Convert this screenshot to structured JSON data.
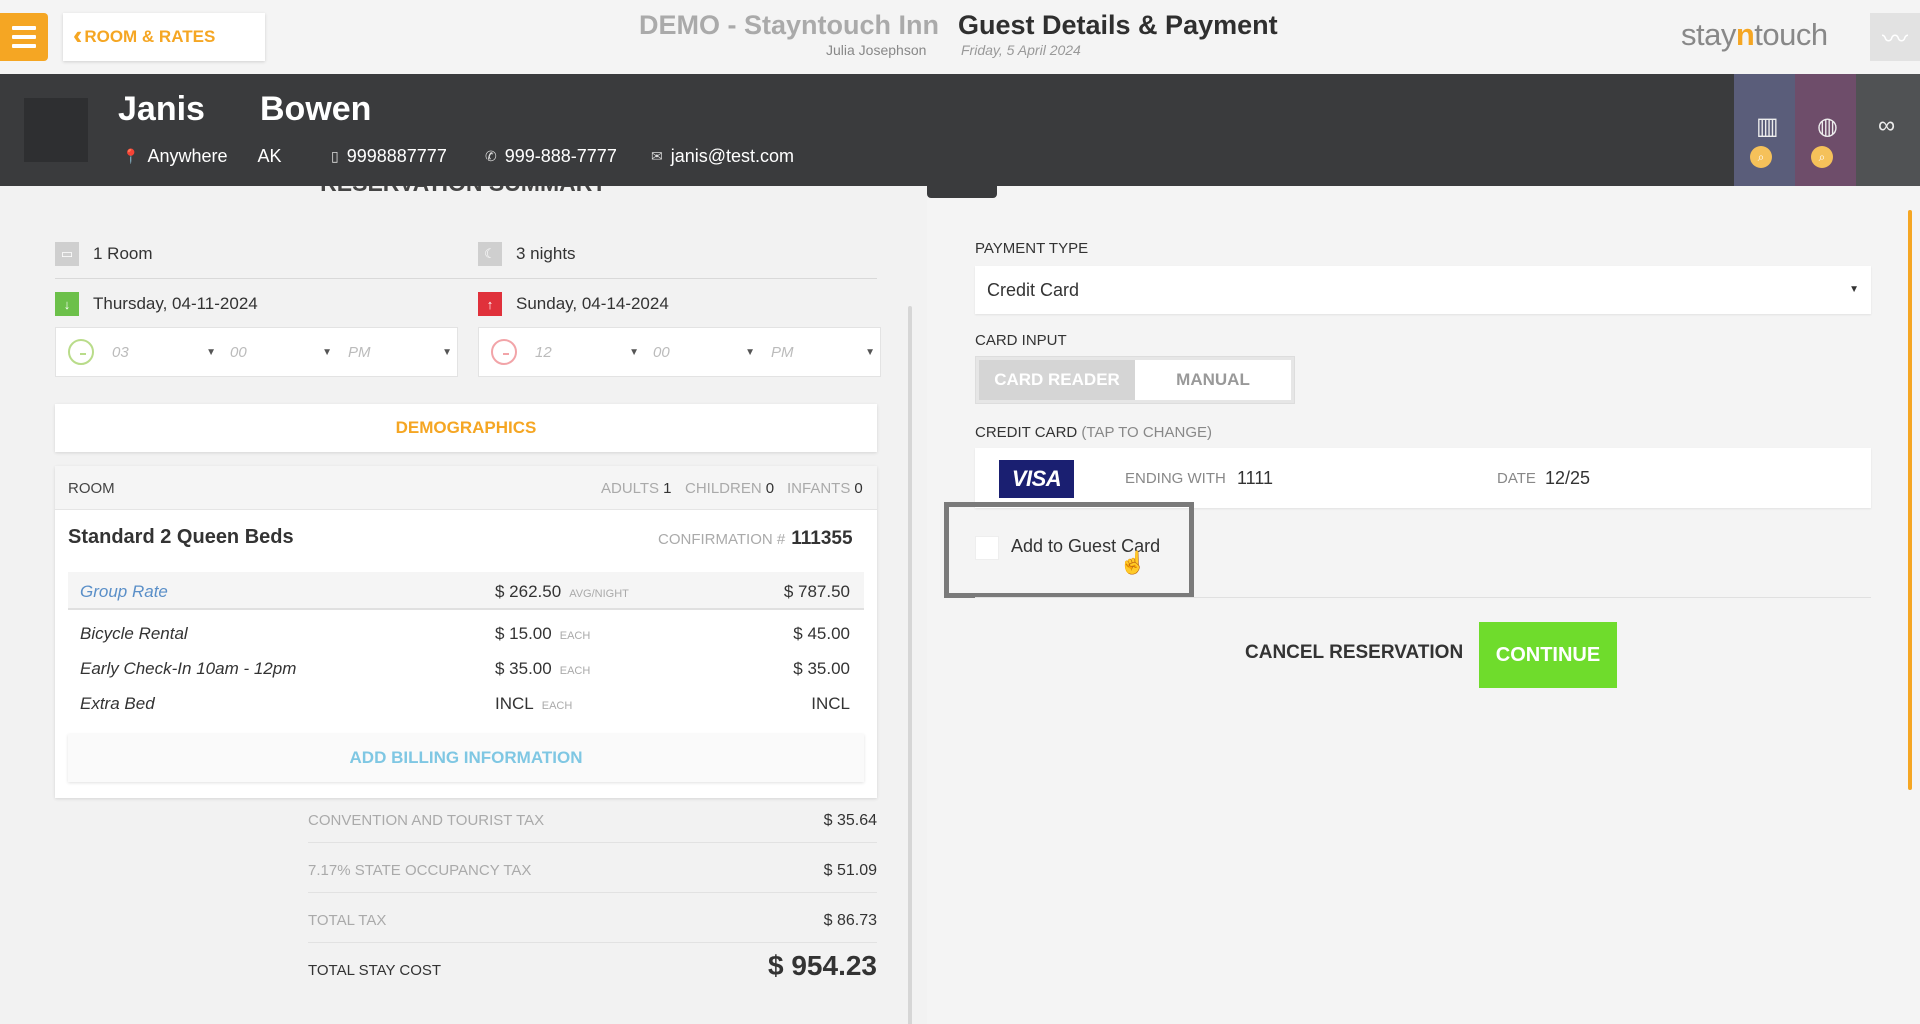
{
  "topbar": {
    "back_label": "ROOM & RATES",
    "hotel_title": "DEMO - Stayntouch Inn",
    "user_name": "Julia Josephson",
    "page_title": "Guest Details & Payment",
    "date": "Friday, 5 April 2024",
    "logo_pre": "stay",
    "logo_mid": "n",
    "logo_post": "touch"
  },
  "guest": {
    "first_name": "Janis",
    "last_name": "Bowen",
    "city": "Anywhere",
    "state": "AK",
    "mobile": "9998887777",
    "phone": "999-888-7777",
    "email": "janis@test.com"
  },
  "summary": {
    "heading": "RESERVATION SUMMARY",
    "rooms": "1 Room",
    "nights": "3 nights",
    "arrival": "Thursday, 04-11-2024",
    "departure": "Sunday, 04-14-2024",
    "arrival_time": {
      "hour": "03",
      "minute": "00",
      "ampm": "PM"
    },
    "departure_time": {
      "hour": "12",
      "minute": "00",
      "ampm": "PM"
    },
    "demographics_label": "DEMOGRAPHICS"
  },
  "room": {
    "label": "ROOM",
    "adults_label": "ADULTS",
    "adults": "1",
    "children_label": "CHILDREN",
    "children": "0",
    "infants_label": "INFANTS",
    "infants": "0",
    "name": "Standard 2 Queen Beds",
    "confirmation_label": "CONFIRMATION #",
    "confirmation": "111355",
    "rate_name": "Group Rate",
    "rate_price": "$ 262.50",
    "rate_unit": "AVG/NIGHT",
    "rate_total": "$ 787.50",
    "addons": [
      {
        "name": "Bicycle Rental",
        "price": "$ 15.00",
        "unit": "EACH",
        "total": "$ 45.00"
      },
      {
        "name": "Early Check-In 10am - 12pm",
        "price": "$ 35.00",
        "unit": "EACH",
        "total": "$ 35.00"
      },
      {
        "name": "Extra Bed",
        "price": "INCL",
        "unit": "EACH",
        "total": "INCL"
      }
    ],
    "billing_label": "ADD BILLING INFORMATION"
  },
  "taxes": [
    {
      "label": "CONVENTION AND TOURIST TAX",
      "amount": "$ 35.64"
    },
    {
      "label": "7.17% STATE OCCUPANCY TAX",
      "amount": "$ 51.09"
    },
    {
      "label": "TOTAL TAX",
      "amount": "$ 86.73"
    }
  ],
  "total": {
    "label": "TOTAL STAY COST",
    "amount": "$ 954.23"
  },
  "payment": {
    "type_label": "PAYMENT TYPE",
    "type_value": "Credit Card",
    "input_label": "CARD INPUT",
    "card_reader": "CARD READER",
    "manual": "MANUAL",
    "cc_label": "CREDIT CARD",
    "cc_hint": "(TAP TO CHANGE)",
    "brand": "VISA",
    "ending_label": "ENDING WITH",
    "ending": "1111",
    "date_label": "DATE",
    "expiry": "12/25",
    "add_guest_card": "Add to Guest Card",
    "cancel": "CANCEL RESERVATION",
    "continue": "CONTINUE"
  },
  "colors": {
    "accent": "#f5a623",
    "header_dark": "#3a3b3d",
    "continue_green": "#6fdc2c",
    "visa_blue": "#1a1f71"
  }
}
